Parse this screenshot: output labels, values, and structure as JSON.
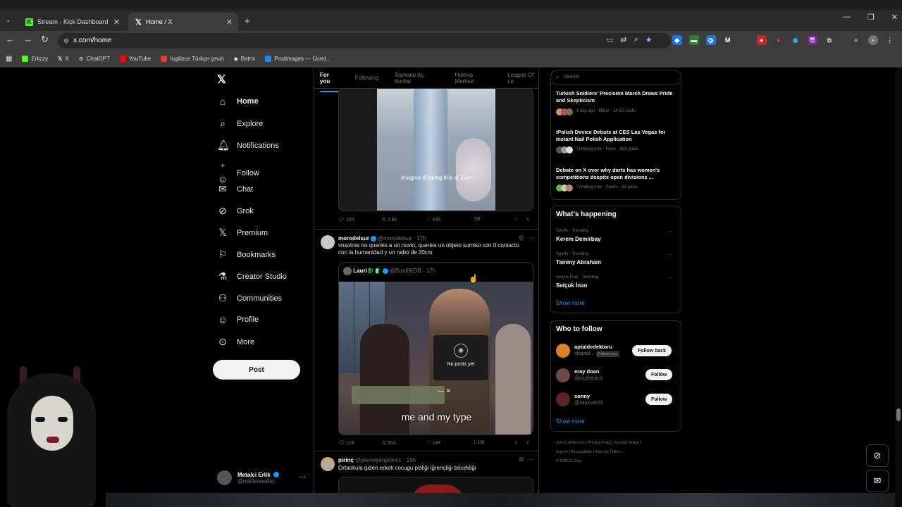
{
  "browser": {
    "tabs": [
      {
        "title": "Stream - Kick Dashboard",
        "active": false
      },
      {
        "title": "Home / X",
        "active": true
      }
    ],
    "url": "x.com/home",
    "bookmarks": [
      "Erlizzy",
      "X",
      "ChatGPT",
      "YouTube",
      "İngilizce Türkçe çeviri",
      "Botrix",
      "Postimages — Ücret..."
    ]
  },
  "sidebar": {
    "items": [
      {
        "label": "Home",
        "icon": "home-icon"
      },
      {
        "label": "Explore",
        "icon": "search-icon"
      },
      {
        "label": "Notifications",
        "icon": "bell-icon"
      },
      {
        "label": "Follow",
        "icon": "person-plus-icon"
      },
      {
        "label": "Chat",
        "icon": "mail-icon"
      },
      {
        "label": "Grok",
        "icon": "grok-icon"
      },
      {
        "label": "Premium",
        "icon": "x-icon"
      },
      {
        "label": "Bookmarks",
        "icon": "bookmark-icon"
      },
      {
        "label": "Creator Studio",
        "icon": "flask-icon"
      },
      {
        "label": "Communities",
        "icon": "people-icon"
      },
      {
        "label": "Profile",
        "icon": "person-icon"
      },
      {
        "label": "More",
        "icon": "more-circle-icon"
      }
    ],
    "post_label": "Post",
    "account": {
      "name": "Metalci Erlik",
      "handle": "@nettleneedto"
    }
  },
  "feed": {
    "tabs": [
      "For you",
      "Following",
      "Tophane Aç Kurtlar",
      "Hiphop Merkezi",
      "League Of Le"
    ],
    "post1": {
      "caption": "imagine drinking this at 2am",
      "replies": "335",
      "reposts": "2.8K",
      "likes": "43K",
      "views": "1M"
    },
    "post2": {
      "name": "morodelsur",
      "handle": "@morodelsur",
      "time": "· 17h",
      "text": "vosotras no queréis a un novio, queréis un objeto sumiso con 0 contacto con la humanidad y un nabo de 20cm",
      "quote": {
        "name": "Lauri🐉🧃",
        "handle": "@BrodilKDB",
        "time": "· 17h",
        "no_posts": "No posts yet",
        "caption": "me and my type"
      },
      "replies": "126",
      "reposts": "664",
      "likes": "19K",
      "views": "1.1M"
    },
    "post3": {
      "name": "pirinç",
      "handle": "@pismeyenpirincc",
      "time": "· 19h",
      "text": "Ortaokula giden erkek cocugu pisliği iğrençliği böcekliği"
    }
  },
  "right": {
    "search_placeholder": "Search",
    "news": [
      {
        "title": "Turkish Soldiers' Precision March Draws Pride and Skepticism",
        "meta": "1 day ago · Other · 24.5K posts"
      },
      {
        "title": "iPolish Device Debuts at CES Las Vegas for Instant Nail Polish Application",
        "meta": "Trending now · News · 680 posts"
      },
      {
        "title": "Debate on X over why darts has women's competitions despite open divisions ...",
        "meta": "Trending now · Sports · 63 posts"
      }
    ],
    "happening": {
      "title": "What's happening",
      "items": [
        {
          "meta": "Sports · Trending",
          "name": "Kerem Demirbay"
        },
        {
          "meta": "Sports · Trending",
          "name": "Tammy Abraham"
        },
        {
          "meta": "Selçuk İnan · Trending",
          "name": "Selçuk İnan"
        }
      ],
      "show_more": "Show more"
    },
    "who_to_follow": {
      "title": "Who to follow",
      "items": [
        {
          "name": "aptaldedektoru",
          "handle": "@aptal...",
          "badge": "Follows you",
          "button": "Follow back"
        },
        {
          "name": "eray doan",
          "handle": "@ozylazarus",
          "button": "Follow"
        },
        {
          "name": "sonny",
          "handle": "@xanxuzs23",
          "button": "Follow"
        }
      ],
      "show_more": "Show more"
    },
    "footer": [
      "Terms of Service",
      "Privacy Policy",
      "Cookie Policy",
      "Imprint",
      "Accessibility",
      "Ads info",
      "More ...",
      "© 2026 X Corp."
    ]
  }
}
